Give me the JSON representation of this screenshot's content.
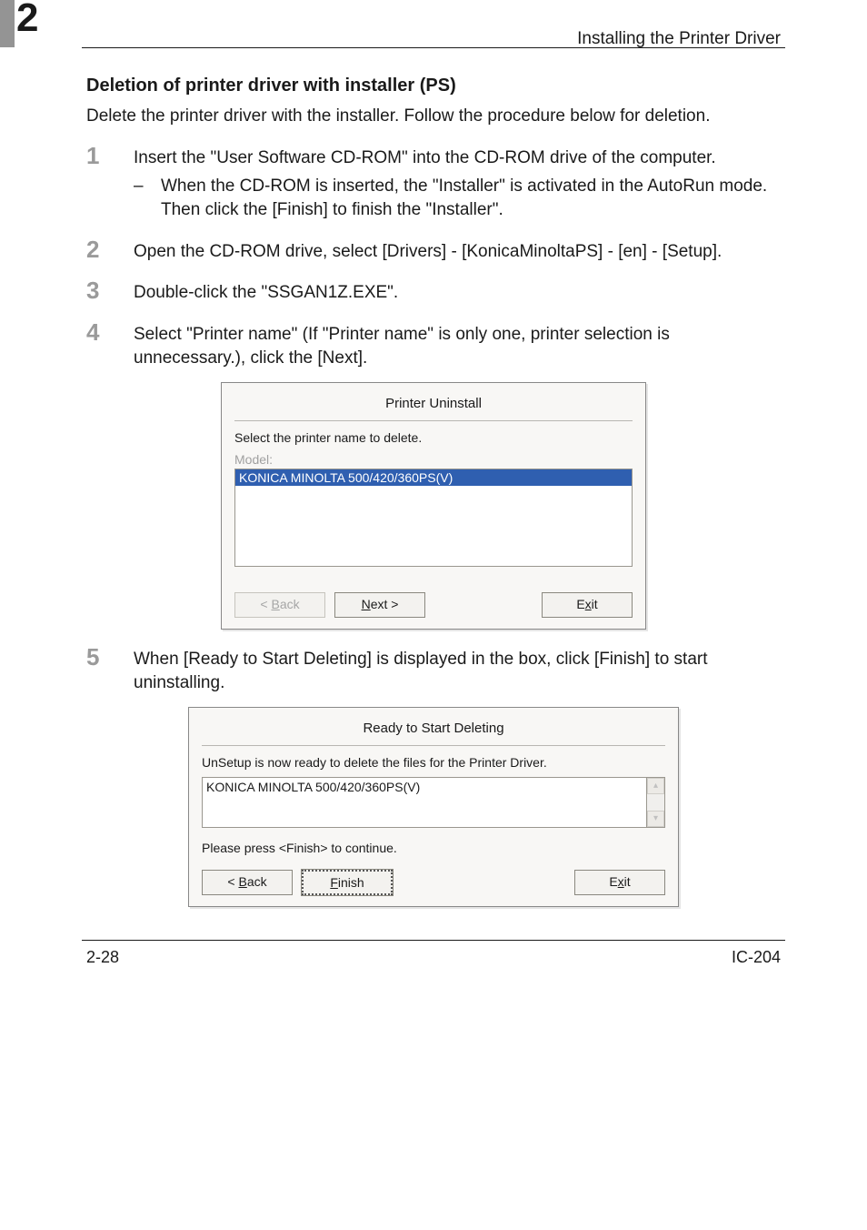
{
  "header": {
    "chapter_number": "2",
    "running_title": "Installing the Printer Driver"
  },
  "section_heading": "Deletion of printer driver with installer (PS)",
  "intro_text": "Delete the printer driver with the installer. Follow the procedure below for deletion.",
  "steps": [
    {
      "num": "1",
      "text": "Insert the \"User Software CD-ROM\" into the CD-ROM drive of the computer.",
      "sub": {
        "dash": "–",
        "text": "When the CD-ROM is inserted, the \"Installer\" is activated in the AutoRun mode. Then click the [Finish] to finish the \"Installer\"."
      }
    },
    {
      "num": "2",
      "text": "Open the CD-ROM drive, select [Drivers] - [KonicaMinoltaPS] - [en] - [Setup]."
    },
    {
      "num": "3",
      "text": "Double-click the \"SSGAN1Z.EXE\"."
    },
    {
      "num": "4",
      "text": "Select \"Printer name\" (If \"Printer name\" is only one, printer selection is unnecessary.), click the [Next]."
    },
    {
      "num": "5",
      "text": "When [Ready to Start Deleting] is displayed in the box, click [Finish] to start uninstalling."
    }
  ],
  "dialog1": {
    "title": "Printer Uninstall",
    "prompt": "Select the printer name to delete.",
    "model_label": "Model:",
    "selected_item": "KONICA MINOLTA 500/420/360PS(V)",
    "btn_back_prefix": "< ",
    "btn_back_u": "B",
    "btn_back_suffix": "ack",
    "btn_next_u": "N",
    "btn_next_suffix": "ext >",
    "btn_exit_prefix": "E",
    "btn_exit_u": "x",
    "btn_exit_suffix": "it"
  },
  "dialog2": {
    "title": "Ready to Start Deleting",
    "prompt": "UnSetup is now ready to delete the files for the Printer Driver.",
    "content": "KONICA MINOLTA 500/420/360PS(V)",
    "continue_text": "Please press <Finish> to continue.",
    "btn_back_prefix": "< ",
    "btn_back_u": "B",
    "btn_back_suffix": "ack",
    "btn_finish_u": "F",
    "btn_finish_suffix": "inish",
    "btn_exit_prefix": "E",
    "btn_exit_u": "x",
    "btn_exit_suffix": "it"
  },
  "footer": {
    "page_number": "2-28",
    "doc_id": "IC-204"
  }
}
